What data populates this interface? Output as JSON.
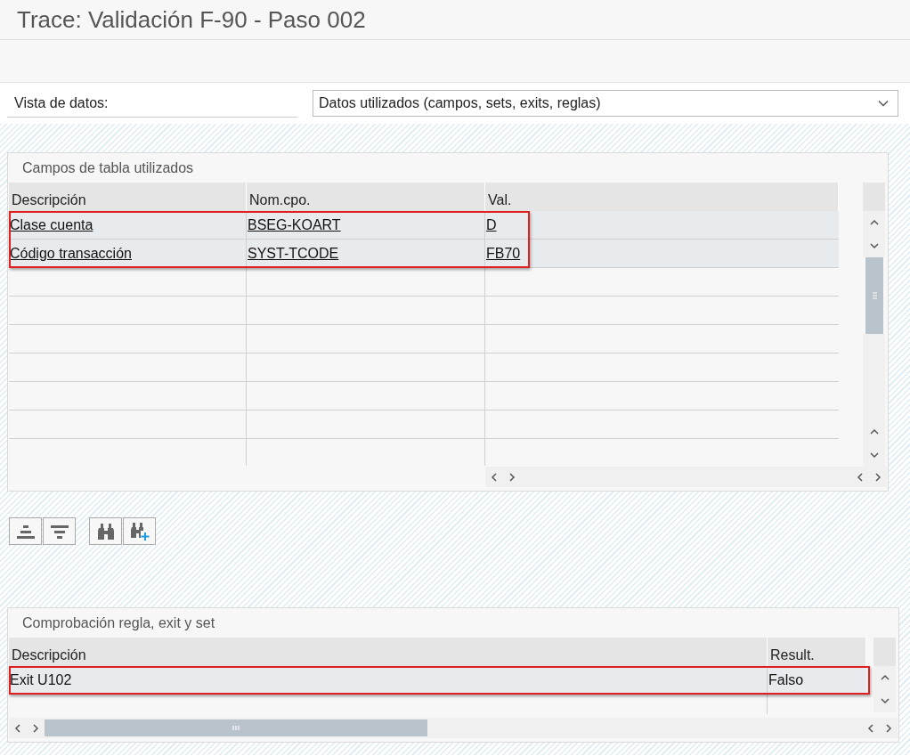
{
  "window": {
    "title": "Trace: Validación F-90 - Paso 002"
  },
  "data_view": {
    "label": "Vista de datos:",
    "value": "Datos utilizados (campos, sets, exits, reglas)"
  },
  "fields_table": {
    "title": "Campos de tabla utilizados",
    "columns": [
      "Descripción",
      "Nom.cpo.",
      "Val."
    ],
    "cells_are_links": true,
    "rows": [
      {
        "cells": [
          "Clase cuenta",
          "BSEG-KOART",
          "D"
        ],
        "highlighted": true
      },
      {
        "cells": [
          "Código transacción",
          "SYST-TCODE",
          "FB70"
        ],
        "highlighted": true
      }
    ]
  },
  "rules_table": {
    "title": "Comprobación regla, exit y set",
    "columns": [
      "Descripción",
      "Result."
    ],
    "cells_are_links": false,
    "rows": [
      {
        "cells": [
          "Exit U102",
          "Falso"
        ],
        "highlighted": true
      }
    ]
  }
}
